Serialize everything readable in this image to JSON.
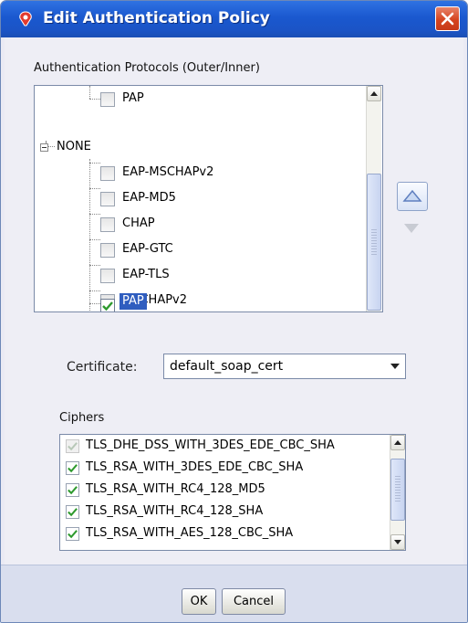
{
  "window": {
    "title": "Edit Authentication Policy"
  },
  "protocols": {
    "label": "Authentication Protocols (Outer/Inner)",
    "rows": [
      {
        "label": "PAP",
        "checked": false
      },
      {
        "label": "NONE",
        "group": true
      },
      {
        "label": "EAP-MSCHAPv2",
        "checked": false,
        "disabled": true
      },
      {
        "label": "EAP-MD5",
        "checked": false,
        "disabled": true
      },
      {
        "label": "CHAP",
        "checked": false
      },
      {
        "label": "EAP-GTC",
        "checked": false
      },
      {
        "label": "EAP-TLS",
        "checked": false
      },
      {
        "label": "MSCHAPv2",
        "checked": false
      },
      {
        "label": "PAP",
        "checked": true,
        "selected": true
      }
    ]
  },
  "certificate": {
    "label": "Certificate:",
    "value": "default_soap_cert"
  },
  "ciphers": {
    "label": "Ciphers",
    "rows": [
      {
        "label": "TLS_DHE_DSS_WITH_3DES_EDE_CBC_SHA",
        "checked": true,
        "disabled": true
      },
      {
        "label": "TLS_RSA_WITH_3DES_EDE_CBC_SHA",
        "checked": true
      },
      {
        "label": "TLS_RSA_WITH_RC4_128_MD5",
        "checked": true
      },
      {
        "label": "TLS_RSA_WITH_RC4_128_SHA",
        "checked": true
      },
      {
        "label": "TLS_RSA_WITH_AES_128_CBC_SHA",
        "checked": true
      }
    ]
  },
  "buttons": {
    "ok": "OK",
    "cancel": "Cancel"
  },
  "colors": {
    "titlebar": "#1b54c6",
    "selection": "#2f5dbf",
    "check": "#2e9a2e"
  }
}
